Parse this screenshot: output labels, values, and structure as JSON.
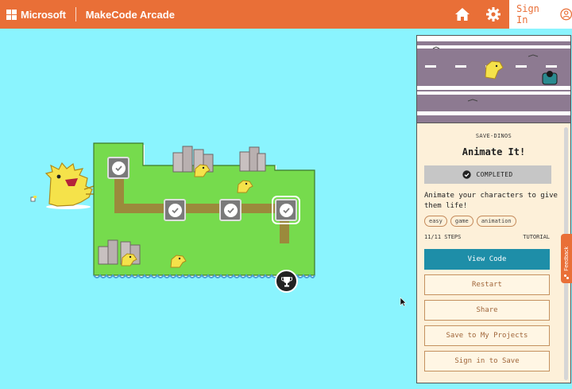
{
  "header": {
    "brand": "Microsoft",
    "app_title": "MakeCode Arcade",
    "signin_label": "Sign In",
    "home_icon": "home-icon",
    "settings_icon": "gear-icon",
    "avatar_icon": "user-circle-icon",
    "background_color": "#e96f37"
  },
  "map": {
    "background_color": "#8af4fe",
    "island_color": "#76db4d",
    "path_color": "#9b8a3c",
    "completed_nodes": 4,
    "trophy_icon": "trophy-icon"
  },
  "panel": {
    "kicker": "SAVE-DINOS",
    "title": "Animate It!",
    "status": "COMPLETED",
    "description": "Animate your characters to give them life!",
    "tags": [
      "easy",
      "game",
      "animation"
    ],
    "steps": "11/11 STEPS",
    "kind": "TUTORIAL",
    "buttons": {
      "view_code": "View Code",
      "restart": "Restart",
      "share": "Share",
      "save": "Save to My Projects",
      "sign_in_save": "Sign in to Save"
    },
    "accent_color": "#1e8ea8"
  },
  "feedback": {
    "label": "Feedback"
  }
}
